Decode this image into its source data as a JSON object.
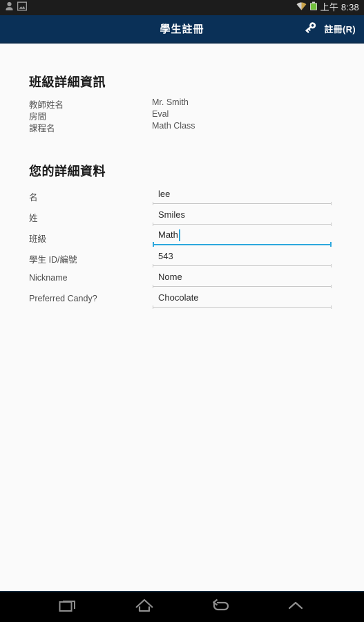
{
  "status_bar": {
    "left_icons": [
      "person-icon",
      "image-icon"
    ],
    "right_icons": [
      "wifi-icon",
      "battery-icon"
    ],
    "clock": "上午 8:38",
    "background": "#1c1c1c"
  },
  "action_bar": {
    "title": "學生註冊",
    "background": "#0a3057",
    "register": {
      "icon": "key-icon",
      "label": "註冊(R)"
    }
  },
  "class_details": {
    "title": "班級詳細資訊",
    "rows": [
      {
        "label": "教師姓名",
        "value": "Mr. Smith"
      },
      {
        "label": "房間",
        "value": "Eval"
      },
      {
        "label": "課程名",
        "value": "Math Class"
      }
    ]
  },
  "your_details": {
    "title": "您的詳細資料",
    "fields": [
      {
        "label": "名",
        "value": "lee",
        "placeholder": "",
        "focused": false
      },
      {
        "label": "姓",
        "value": "Smiles",
        "placeholder": "",
        "focused": false
      },
      {
        "label": "班級",
        "value": "Math",
        "placeholder": "",
        "focused": true
      },
      {
        "label": "學生 ID/編號",
        "value": "543",
        "placeholder": "",
        "focused": false
      },
      {
        "label": "Nickname",
        "value": "Nome",
        "placeholder": "",
        "focused": false
      },
      {
        "label": "Preferred Candy?",
        "value": "Chocolate",
        "placeholder": "",
        "focused": false
      }
    ],
    "focus_color": "#2ca7dd"
  },
  "nav_bar": {
    "buttons": [
      {
        "name": "recents-icon"
      },
      {
        "name": "home-icon"
      },
      {
        "name": "back-icon"
      },
      {
        "name": "chevron-up-icon"
      }
    ],
    "background": "#000000"
  }
}
